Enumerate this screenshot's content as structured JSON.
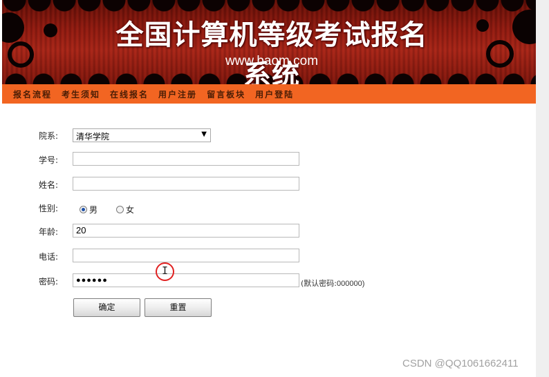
{
  "banner": {
    "title": "全国计算机等级考试报名系统",
    "url": "www.baom.com"
  },
  "nav": {
    "items": [
      "报名流程",
      "考生须知",
      "在线报名",
      "用户注册",
      "留言板块",
      "用户登陆"
    ]
  },
  "form": {
    "college": {
      "label": "院系:",
      "value": "清华学院"
    },
    "student_id": {
      "label": "学号:",
      "value": ""
    },
    "name": {
      "label": "姓名:",
      "value": ""
    },
    "gender": {
      "label": "性别:",
      "options": [
        "男",
        "女"
      ],
      "selected": "男"
    },
    "age": {
      "label": "年龄:",
      "value": "20"
    },
    "phone": {
      "label": "电话:",
      "value": ""
    },
    "password": {
      "label": "密码:",
      "value": "●●●●●●",
      "hint_prefix": "(默认密码:",
      "hint_value": "000000)"
    },
    "submit_label": "确定",
    "reset_label": "重置"
  },
  "watermark": "CSDN @QQ1061662411",
  "colors": {
    "nav_bg": "#f26522",
    "banner_red": "#a52417"
  }
}
